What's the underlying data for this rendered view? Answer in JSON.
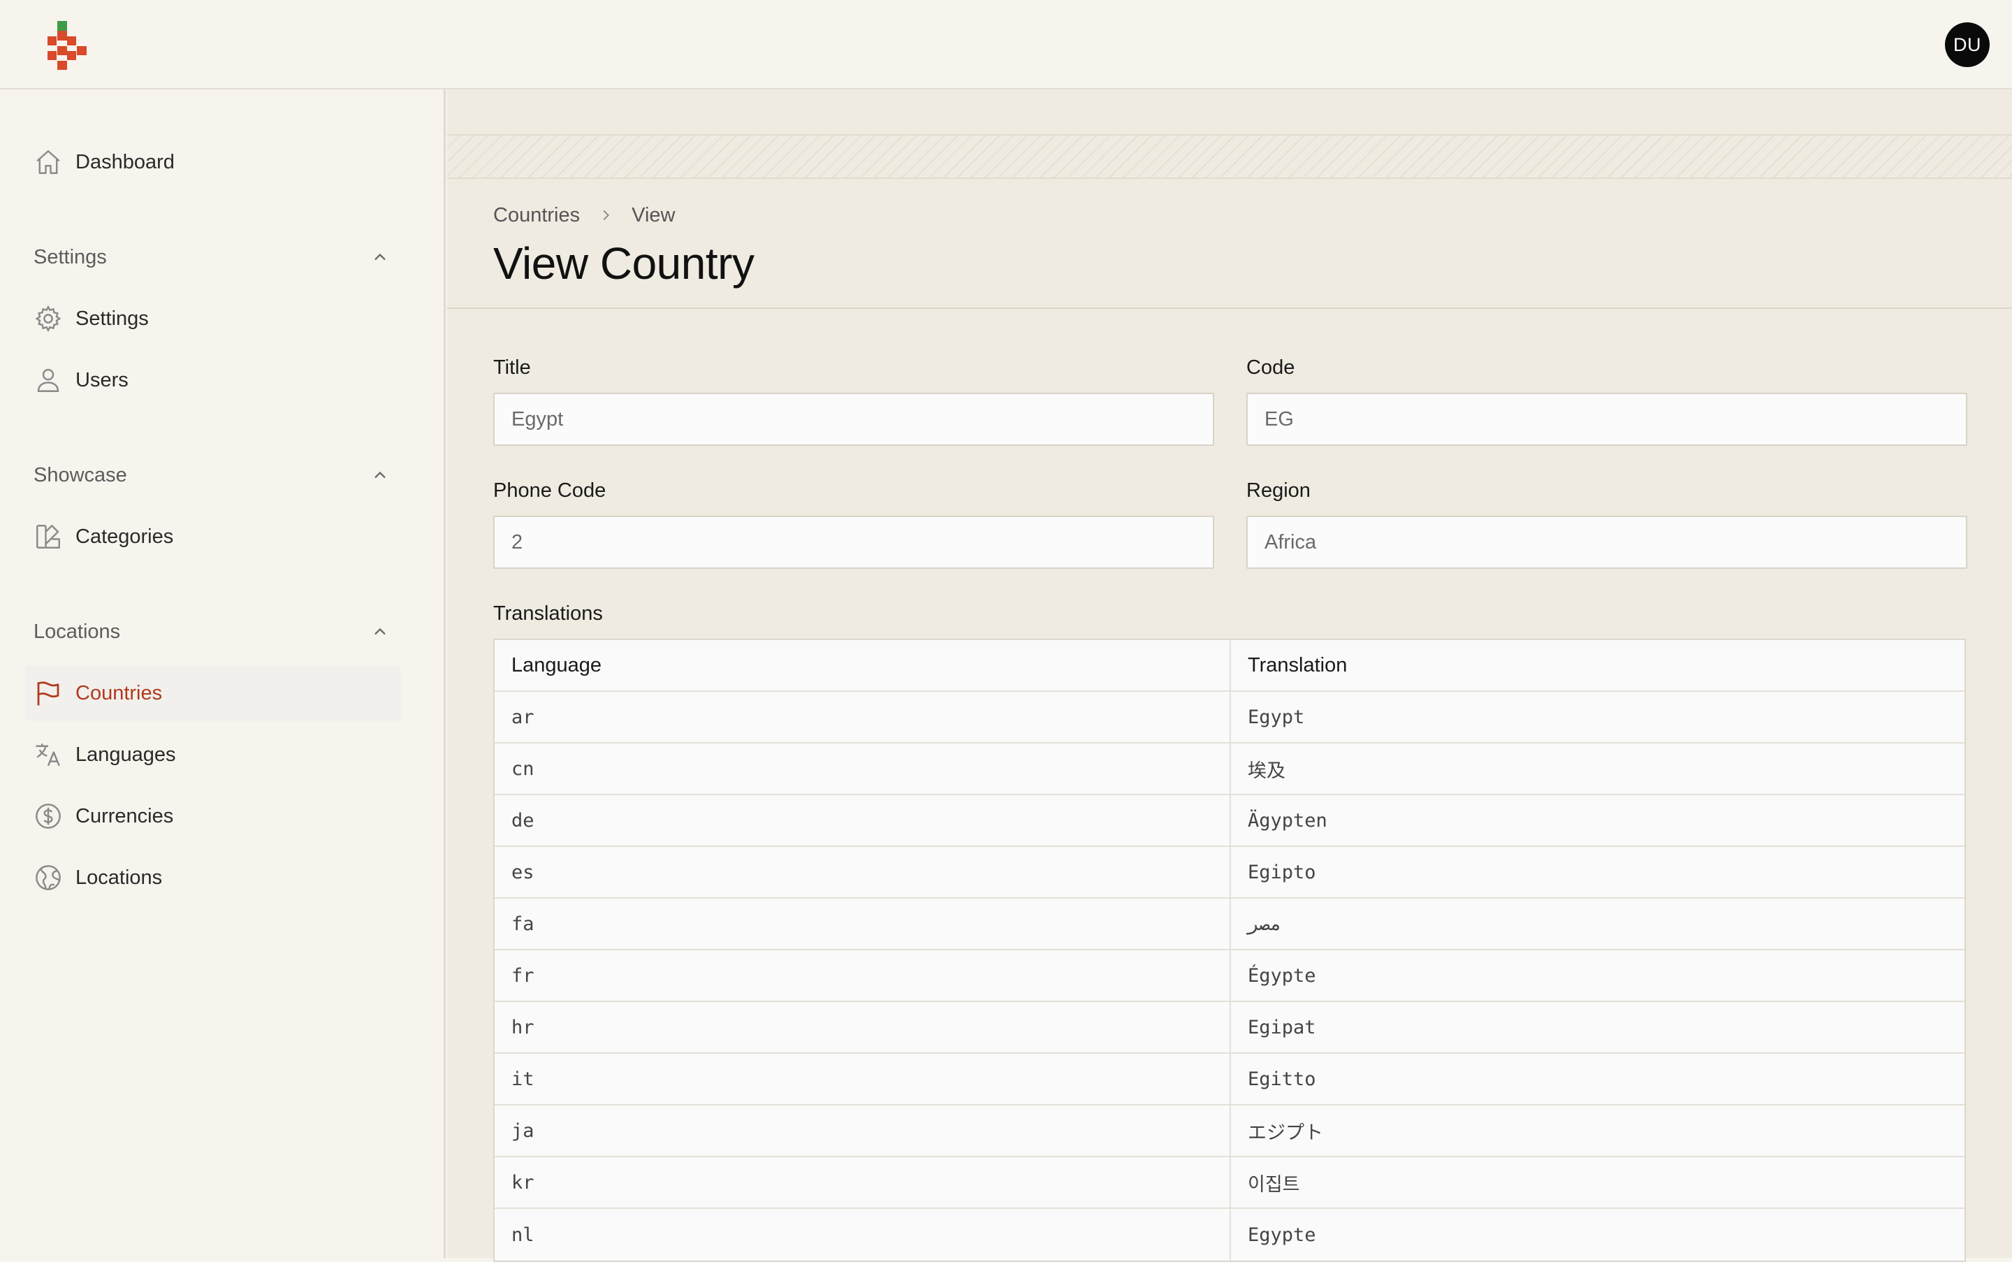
{
  "header": {
    "avatar_initials": "DU",
    "logo_icon": "checkered-logo-icon",
    "brand_colors": {
      "green": "#3f9b46",
      "red": "#d84a2a"
    }
  },
  "sidebar": {
    "dashboard": {
      "label": "Dashboard",
      "icon": "home-icon"
    },
    "sections": [
      {
        "label": "Settings",
        "items": [
          {
            "label": "Settings",
            "icon": "gear-icon"
          },
          {
            "label": "Users",
            "icon": "user-icon"
          }
        ]
      },
      {
        "label": "Showcase",
        "items": [
          {
            "label": "Categories",
            "icon": "swatch-icon"
          }
        ]
      },
      {
        "label": "Locations",
        "items": [
          {
            "label": "Countries",
            "icon": "flag-icon",
            "active": true
          },
          {
            "label": "Languages",
            "icon": "translate-icon"
          },
          {
            "label": "Currencies",
            "icon": "dollar-circle-icon"
          },
          {
            "label": "Locations",
            "icon": "globe-icon"
          }
        ]
      }
    ],
    "active_color": "#b23a1f"
  },
  "breadcrumb": {
    "parent": "Countries",
    "current": "View"
  },
  "page": {
    "title": "View Country"
  },
  "form": {
    "title": {
      "label": "Title",
      "value": "Egypt"
    },
    "code": {
      "label": "Code",
      "value": "EG"
    },
    "phone_code": {
      "label": "Phone Code",
      "value": "2"
    },
    "region": {
      "label": "Region",
      "value": "Africa"
    }
  },
  "translations": {
    "label": "Translations",
    "columns": [
      "Language",
      "Translation"
    ],
    "rows": [
      [
        "ar",
        "Egypt"
      ],
      [
        "cn",
        "埃及"
      ],
      [
        "de",
        "Ägypten"
      ],
      [
        "es",
        "Egipto"
      ],
      [
        "fa",
        "مصر"
      ],
      [
        "fr",
        "Égypte"
      ],
      [
        "hr",
        "Egipat"
      ],
      [
        "it",
        "Egitto"
      ],
      [
        "ja",
        "エジプト"
      ],
      [
        "kr",
        "이집트"
      ],
      [
        "nl",
        "Egypte"
      ]
    ]
  }
}
